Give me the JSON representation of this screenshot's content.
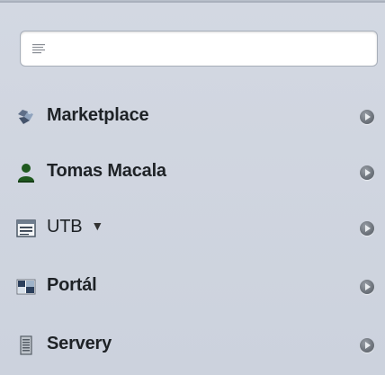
{
  "search": {
    "value": "",
    "placeholder": ""
  },
  "nav": {
    "items": [
      {
        "label": "Marketplace",
        "icon": "marketplace-icon"
      },
      {
        "label": "Tomas Macala",
        "icon": "user-icon"
      },
      {
        "label": "UTB",
        "icon": "list-window-icon",
        "caret": "▼"
      },
      {
        "label": "Portál",
        "icon": "portal-icon"
      },
      {
        "label": "Servery",
        "icon": "server-icon"
      }
    ]
  }
}
